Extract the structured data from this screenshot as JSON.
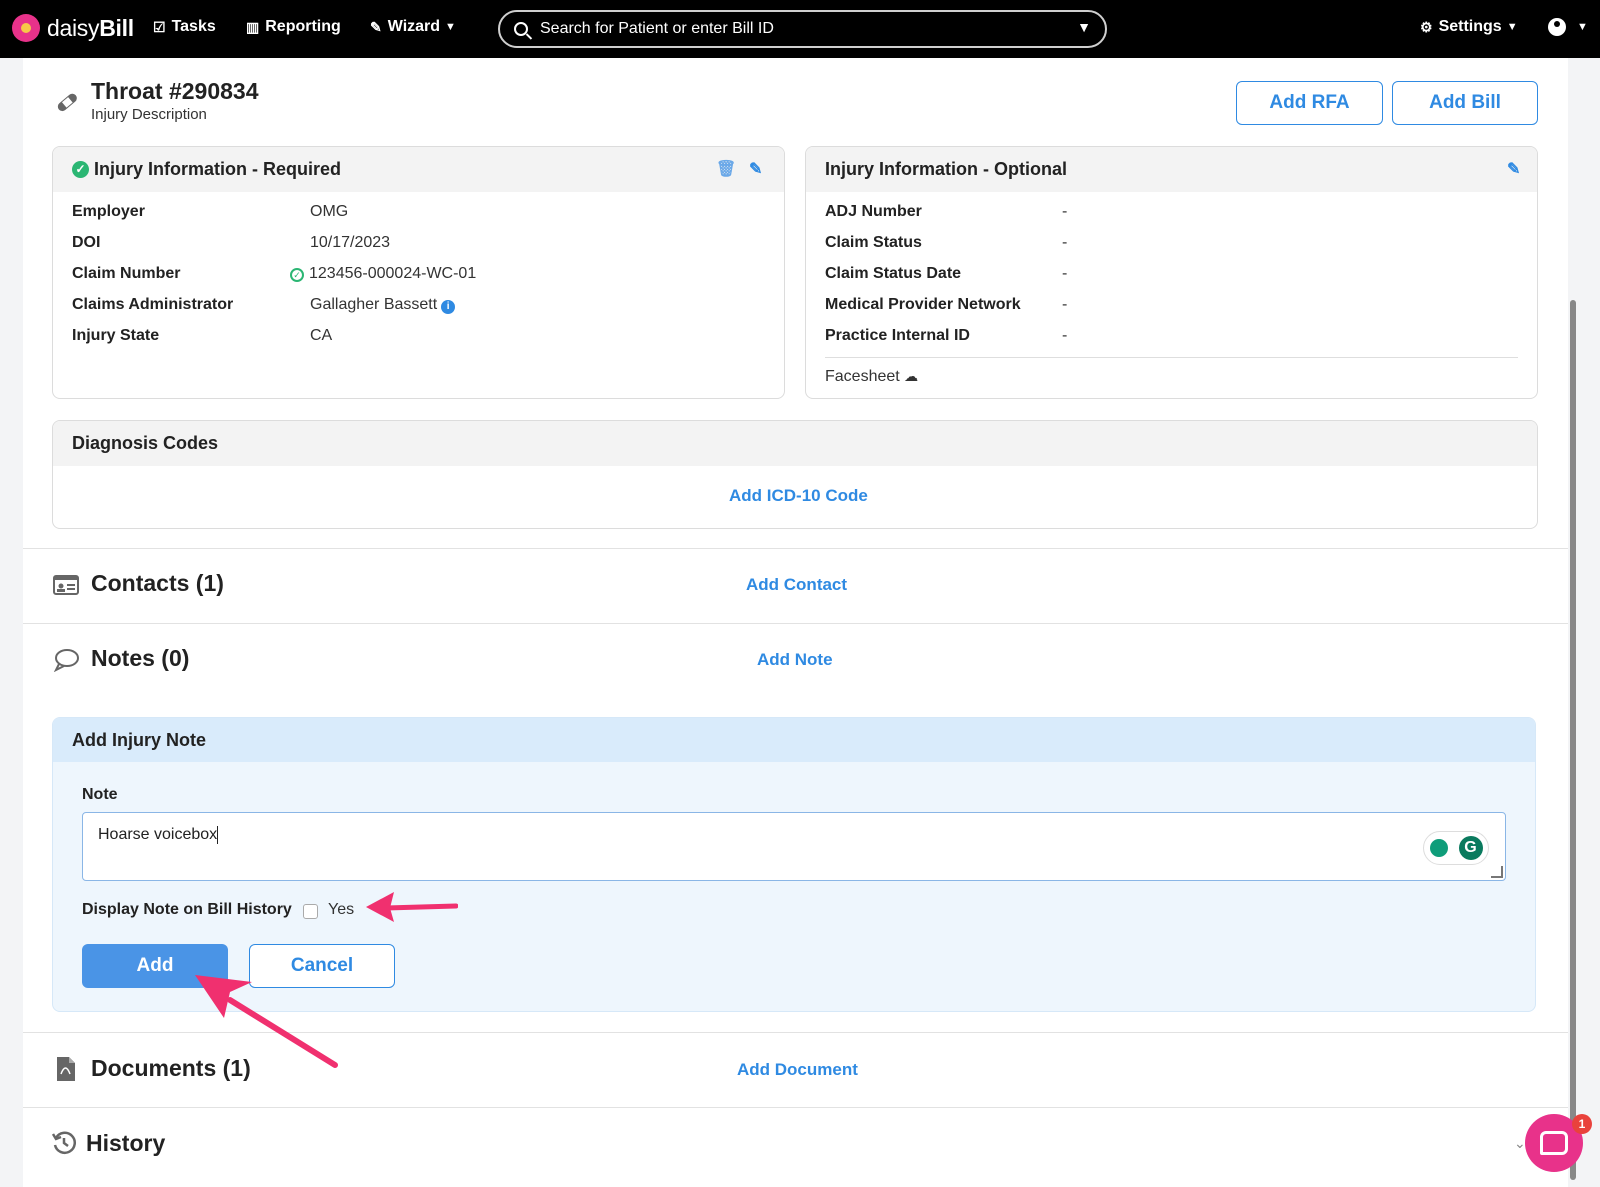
{
  "nav": {
    "brand_light": "daisy",
    "brand_bold": "Bill",
    "tasks": "Tasks",
    "reporting": "Reporting",
    "wizard": "Wizard",
    "search_placeholder": "Search for Patient or enter Bill ID",
    "settings": "Settings"
  },
  "injury": {
    "title": "Throat #290834",
    "subtitle": "Injury Description",
    "add_rfa": "Add RFA",
    "add_bill": "Add Bill"
  },
  "required": {
    "heading": "Injury Information - Required",
    "rows": [
      {
        "label": "Employer",
        "value": "OMG"
      },
      {
        "label": "DOI",
        "value": "10/17/2023"
      },
      {
        "label": "Claim Number",
        "value": "123456-000024-WC-01"
      },
      {
        "label": "Claims Administrator",
        "value": "Gallagher Bassett"
      },
      {
        "label": "Injury State",
        "value": "CA"
      }
    ]
  },
  "optional": {
    "heading": "Injury Information - Optional",
    "rows": [
      {
        "label": "ADJ Number",
        "value": "-"
      },
      {
        "label": "Claim Status",
        "value": "-"
      },
      {
        "label": "Claim Status Date",
        "value": "-"
      },
      {
        "label": "Medical Provider Network",
        "value": "-"
      },
      {
        "label": "Practice Internal ID",
        "value": "-"
      }
    ],
    "facesheet": "Facesheet"
  },
  "diagnosis": {
    "heading": "Diagnosis Codes",
    "add_link": "Add ICD-10 Code"
  },
  "contacts": {
    "title": "Contacts (1)",
    "link": "Add Contact"
  },
  "notes": {
    "title": "Notes (0)",
    "link": "Add Note"
  },
  "note_form": {
    "heading": "Add Injury Note",
    "note_label": "Note",
    "note_value": "Hoarse voicebox",
    "display_label": "Display Note on Bill History",
    "yes_label": "Yes",
    "add_button": "Add",
    "cancel_button": "Cancel"
  },
  "documents": {
    "title": "Documents (1)",
    "link": "Add Document"
  },
  "history": {
    "title": "History"
  },
  "chat": {
    "badge": "1"
  },
  "colors": {
    "accent": "#2f8ae2",
    "brand": "#e8328a",
    "arrow": "#f0306f",
    "success": "#2bb673"
  }
}
